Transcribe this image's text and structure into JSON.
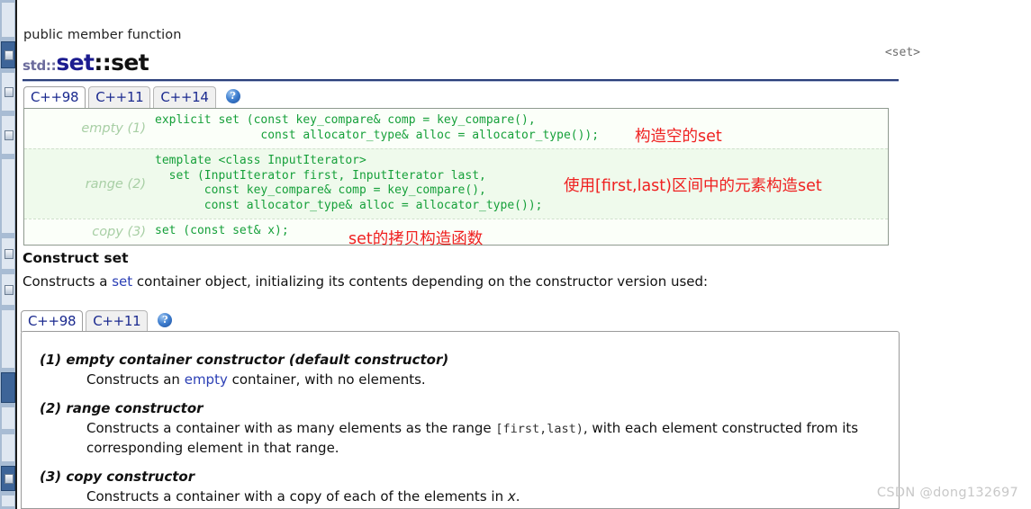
{
  "taskbar": {
    "label": "windows-taskbar-strip"
  },
  "header": {
    "kicker": "public member function",
    "title_namespace": "std::",
    "title_class": "set",
    "title_separator": "::",
    "title_member": "set",
    "header_tag": "<set>"
  },
  "standard_tabs": {
    "items": [
      {
        "label": "C++98",
        "active": true
      },
      {
        "label": "C++11",
        "active": false
      },
      {
        "label": "C++14",
        "active": false
      }
    ],
    "help_label": "?"
  },
  "signatures": {
    "rows": [
      {
        "tag": "empty (1)",
        "code": "explicit set (const key_compare& comp = key_compare(),\n               const allocator_type& alloc = allocator_type());",
        "alt": false
      },
      {
        "tag": "range (2)",
        "code": "template <class InputIterator>\n  set (InputIterator first, InputIterator last,\n       const key_compare& comp = key_compare(),\n       const allocator_type& alloc = allocator_type());",
        "alt": true
      },
      {
        "tag": "copy (3)",
        "code": "set (const set& x);",
        "alt": false
      }
    ]
  },
  "annotations": {
    "empty": "构造空的set",
    "range": "使用[first,last)区间中的元素构造set",
    "copy": "set的拷贝构造函数"
  },
  "section": {
    "title": "Construct set",
    "desc_before": "Constructs a ",
    "desc_link": "set",
    "desc_after": " container object, initializing its contents depending on the constructor version used:"
  },
  "desc_tabs": {
    "items": [
      {
        "label": "C++98",
        "active": true
      },
      {
        "label": "C++11",
        "active": false
      }
    ],
    "help_label": "?"
  },
  "descriptions": [
    {
      "heading": "(1) empty container constructor (default constructor)",
      "body_1": "Constructs an ",
      "body_link": "empty",
      "body_2": " container, with no elements.",
      "body_mono": "",
      "body_3": "",
      "body_ital": "",
      "body_4": ""
    },
    {
      "heading": "(2) range constructor",
      "body_1": "Constructs a container with as many elements as the range ",
      "body_link": "",
      "body_2": "",
      "body_mono": "[first,last)",
      "body_3": ", with each element constructed from its corresponding element in that range.",
      "body_ital": "",
      "body_4": ""
    },
    {
      "heading": "(3) copy constructor",
      "body_1": "Constructs a container with a copy of each of the elements in ",
      "body_link": "",
      "body_2": "",
      "body_mono": "",
      "body_3": "",
      "body_ital": "x",
      "body_4": "."
    }
  ],
  "watermark": "CSDN @dong132697",
  "colors": {
    "code_green": "#16a03a",
    "annotation_red": "#ef2020",
    "link_blue": "#2b3fb5",
    "title_blue": "#1b1b8f"
  }
}
